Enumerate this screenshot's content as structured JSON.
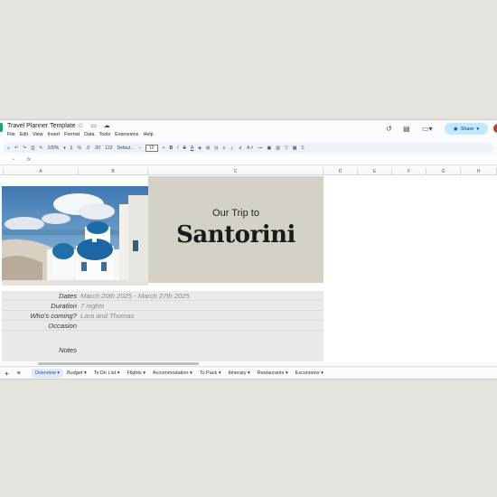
{
  "app": {
    "doc_title": "Travel Planner Template",
    "title_icons": "☆ ▭ ☁",
    "menu": [
      "File",
      "Edit",
      "View",
      "Insert",
      "Format",
      "Data",
      "Tools",
      "Extensions",
      "Help"
    ],
    "share_label": "Share"
  },
  "toolbar": {
    "zoom": "100%",
    "font": "Defaul...",
    "font_size": "10",
    "num_123": "123"
  },
  "formula_bar": {
    "cell_ref": "•",
    "fx": "fx"
  },
  "columns": [
    "A",
    "B",
    "C",
    "D",
    "E",
    "F",
    "G",
    "H"
  ],
  "hero": {
    "subtitle": "Our Trip to",
    "title": "Santorini"
  },
  "details": {
    "dates_label": "Dates",
    "dates_value": "March 20th 2025 - March 27th 2025",
    "duration_label": "Duration",
    "duration_value": "7 nights",
    "who_label": "Who's coming?",
    "who_value": "Lara and Thomas",
    "occasion_label": "Occasion",
    "notes_label": "Notes"
  },
  "sheet_tabs": [
    "Overview",
    "Budget",
    "To Do List",
    "Flights",
    "Accommodation",
    "To Pack",
    "Itinerary",
    "Restaurants",
    "Excursions"
  ],
  "colors": {
    "hero_bg": "#d4d1c6",
    "share_bg": "#c2e7ff",
    "active_tab": "#0b57d0"
  }
}
